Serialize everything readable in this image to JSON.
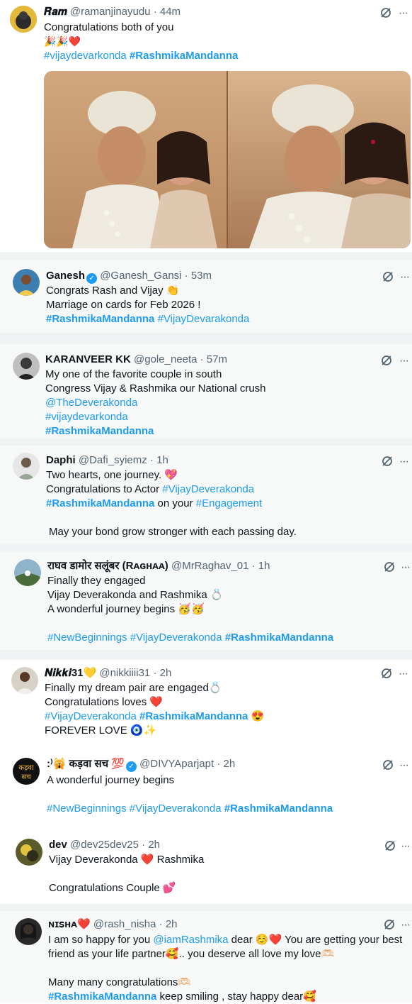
{
  "tweets": [
    {
      "name": "𝑹𝒂𝒎",
      "handle": "@ramanjinayudu",
      "time": "44m",
      "lines": [
        "Congratulations both of you",
        "🎉🎉❤️"
      ],
      "tag_line": [
        "#vijaydevarkonda",
        "#RashmikaMandanna"
      ]
    },
    {
      "name": "Ganesh",
      "verified": "✓",
      "handle": "@Ganesh_Gansi",
      "time": "53m",
      "lines": [
        "Congrats Rash and Vijay 👏",
        "Marriage on cards for Feb 2026 !"
      ],
      "tag_line": [
        "#RashmikaMandanna",
        "#VijayDevarakonda"
      ]
    },
    {
      "name": "KARANVEER KK",
      "handle": "@gole_neeta",
      "time": "57m",
      "lines": [
        "My one of the favorite couple in south",
        "Congress Vijay & Rashmika our National crush",
        "@TheDeverakonda",
        "#vijaydevarkonda",
        "#RashmikaMandanna"
      ]
    },
    {
      "name": "Daphi",
      "handle": "@Dafi_syiemz",
      "time": "1h",
      "lines": [
        "Two hearts, one journey. 💖",
        "Congratulations to Actor ",
        "#VijayDeverakonda",
        "#RashmikaMandanna",
        " on your ",
        "#Engagement",
        "May your bond grow stronger with each passing day."
      ]
    },
    {
      "name": "राघव डामोर सलूंबर (Rᴀɢʜᴀᴀ)",
      "handle": "@MrRaghav_01",
      "time": "1h",
      "lines": [
        "Finally they engaged",
        "Vijay Deverakonda and Rashmika 💍",
        "A wonderful journey begins 🥳🥳"
      ],
      "tag_line": [
        "#NewBeginnings",
        "#VijayDeverakonda",
        "#RashmikaMandanna"
      ]
    },
    {
      "name": "𝑵𝒊𝒌𝒌𝒊31💛",
      "handle": "@nikkiiii31",
      "time": "2h",
      "lines": [
        "Finally my dream pair are engaged💍",
        "Congratulations loves ❤️",
        "#VijayDeverakonda",
        "#RashmikaMandanna",
        " 😍",
        "FOREVER LOVE 🧿✨"
      ]
    },
    {
      "name": ":⁾🙀 कड़वा सच 💯",
      "verified": "✓",
      "handle": "@DIVYAparjapt",
      "time": "2h",
      "lines": [
        "A wonderful journey begins"
      ],
      "tag_line": [
        "#NewBeginnings",
        "#VijayDeverakonda",
        "#RashmikaMandanna"
      ]
    },
    {
      "name": "dev",
      "handle": "@dev25dev25",
      "time": "2h",
      "lines": [
        "Vijay Deverakonda ❤️ Rashmika",
        "Congratulations Couple 💕"
      ]
    },
    {
      "name": "ɴɪꜱʜᴀ❤️",
      "handle": "@rash_nisha",
      "time": "2h",
      "lines": [
        "I am so happy for you ",
        "@iamRashmika",
        " dear ☺️❤️ You are getting your best",
        "friend as your life partner🥰.. you deserve all love my love🫶🏻",
        "Many many congratulations🫶🏻",
        "#RashmikaMandanna",
        " keep smiling , stay happy dear🥰"
      ]
    }
  ],
  "separator": " · ",
  "more_icon": "···",
  "colors": {
    "link": "#1d9bf0",
    "muted": "#536471",
    "text": "#0f1419",
    "divider": "#eff3f4"
  }
}
